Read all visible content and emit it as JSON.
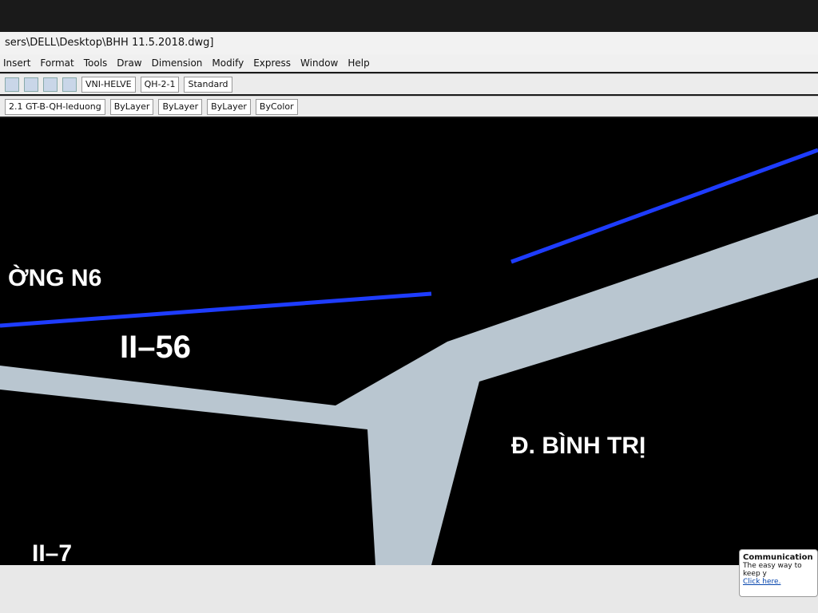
{
  "window": {
    "title": "sers\\DELL\\Desktop\\BHH 11.5.2018.dwg]"
  },
  "menu": [
    "Insert",
    "Format",
    "Tools",
    "Draw",
    "Dimension",
    "Modify",
    "Express",
    "Window",
    "Help"
  ],
  "toolbar1": {
    "text_style": "VNI-HELVE",
    "dim_style": "QH-2-1",
    "table_style": "Standard"
  },
  "toolbar2": {
    "layer": "2.1 GT-B-QH-leduong",
    "color": "ByLayer",
    "linetype": "ByLayer",
    "lineweight": "ByLayer",
    "plotstyle": "ByColor"
  },
  "drawing": {
    "street_n6": "ỜNG N6",
    "block_1156": "II–56",
    "street_binh_tri": "Đ. BÌNH TRỊ",
    "block_ii7": "II–7"
  },
  "notification": {
    "title": "Communication",
    "body": "The easy way to keep y",
    "link": "Click here."
  }
}
